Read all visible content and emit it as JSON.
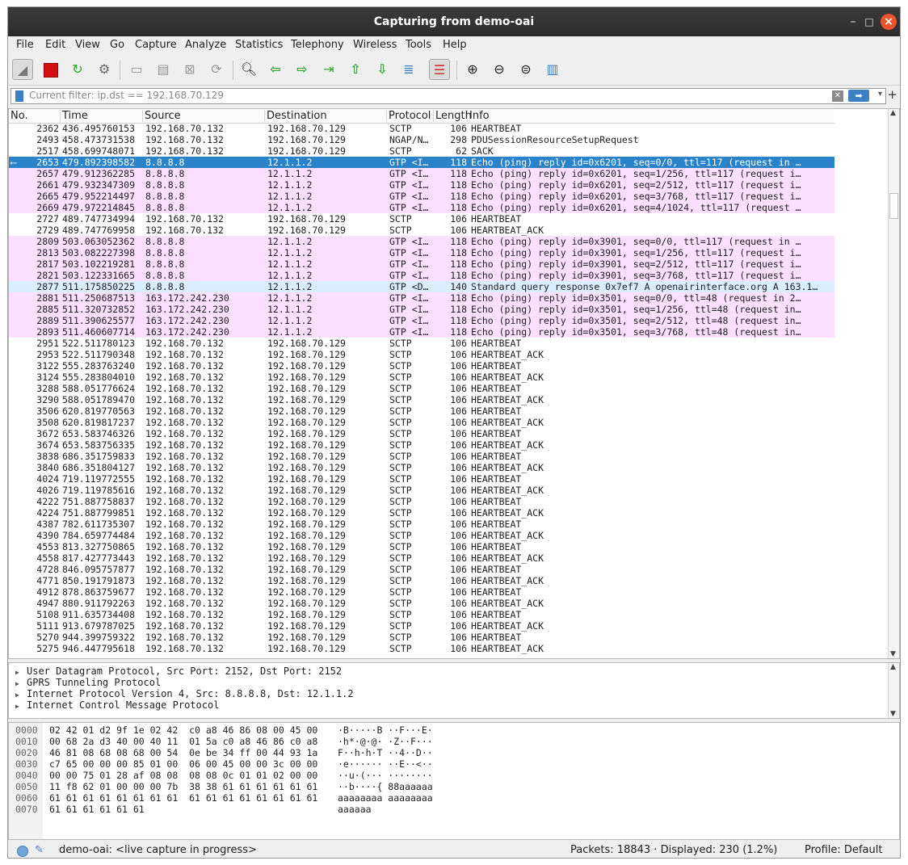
{
  "window": {
    "title": "Capturing from demo-oai"
  },
  "menu": [
    "File",
    "Edit",
    "View",
    "Go",
    "Capture",
    "Analyze",
    "Statistics",
    "Telephony",
    "Wireless",
    "Tools",
    "Help"
  ],
  "filter": {
    "placeholder": "Current filter: ip.dst == 192.168.70.129",
    "value": ""
  },
  "columns": [
    "No.",
    "Time",
    "Source",
    "Destination",
    "Protocol",
    "Length",
    "Info"
  ],
  "packets": [
    {
      "no": "2362",
      "time": "436.495760153",
      "src": "192.168.70.132",
      "dst": "192.168.70.129",
      "proto": "SCTP",
      "len": "106",
      "info": "HEARTBEAT",
      "style": "normal"
    },
    {
      "no": "2493",
      "time": "458.473731538",
      "src": "192.168.70.132",
      "dst": "192.168.70.129",
      "proto": "NGAP/N…",
      "len": "298",
      "info": "PDUSessionResourceSetupRequest",
      "style": "normal"
    },
    {
      "no": "2517",
      "time": "458.699748071",
      "src": "192.168.70.132",
      "dst": "192.168.70.129",
      "proto": "SCTP",
      "len": "62",
      "info": "SACK",
      "style": "normal"
    },
    {
      "no": "2653",
      "time": "479.892398582",
      "src": "8.8.8.8",
      "dst": "12.1.1.2",
      "proto": "GTP <I…",
      "len": "118",
      "info": "Echo (ping) reply    id=0x6201, seq=0/0, ttl=117 (request in …",
      "style": "sel"
    },
    {
      "no": "2657",
      "time": "479.912362285",
      "src": "8.8.8.8",
      "dst": "12.1.1.2",
      "proto": "GTP <I…",
      "len": "118",
      "info": "Echo (ping) reply    id=0x6201, seq=1/256, ttl=117 (request i…",
      "style": "icmp"
    },
    {
      "no": "2661",
      "time": "479.932347309",
      "src": "8.8.8.8",
      "dst": "12.1.1.2",
      "proto": "GTP <I…",
      "len": "118",
      "info": "Echo (ping) reply    id=0x6201, seq=2/512, ttl=117 (request i…",
      "style": "icmp"
    },
    {
      "no": "2665",
      "time": "479.952214497",
      "src": "8.8.8.8",
      "dst": "12.1.1.2",
      "proto": "GTP <I…",
      "len": "118",
      "info": "Echo (ping) reply    id=0x6201, seq=3/768, ttl=117 (request i…",
      "style": "icmp"
    },
    {
      "no": "2669",
      "time": "479.972214845",
      "src": "8.8.8.8",
      "dst": "12.1.1.2",
      "proto": "GTP <I…",
      "len": "118",
      "info": "Echo (ping) reply    id=0x6201, seq=4/1024, ttl=117 (request …",
      "style": "icmp"
    },
    {
      "no": "2727",
      "time": "489.747734994",
      "src": "192.168.70.132",
      "dst": "192.168.70.129",
      "proto": "SCTP",
      "len": "106",
      "info": "HEARTBEAT",
      "style": "normal"
    },
    {
      "no": "2729",
      "time": "489.747769958",
      "src": "192.168.70.132",
      "dst": "192.168.70.129",
      "proto": "SCTP",
      "len": "106",
      "info": "HEARTBEAT_ACK",
      "style": "normal"
    },
    {
      "no": "2809",
      "time": "503.063052362",
      "src": "8.8.8.8",
      "dst": "12.1.1.2",
      "proto": "GTP <I…",
      "len": "118",
      "info": "Echo (ping) reply    id=0x3901, seq=0/0, ttl=117 (request in …",
      "style": "icmp"
    },
    {
      "no": "2813",
      "time": "503.082227398",
      "src": "8.8.8.8",
      "dst": "12.1.1.2",
      "proto": "GTP <I…",
      "len": "118",
      "info": "Echo (ping) reply    id=0x3901, seq=1/256, ttl=117 (request i…",
      "style": "icmp"
    },
    {
      "no": "2817",
      "time": "503.102219281",
      "src": "8.8.8.8",
      "dst": "12.1.1.2",
      "proto": "GTP <I…",
      "len": "118",
      "info": "Echo (ping) reply    id=0x3901, seq=2/512, ttl=117 (request i…",
      "style": "icmp"
    },
    {
      "no": "2821",
      "time": "503.122331665",
      "src": "8.8.8.8",
      "dst": "12.1.1.2",
      "proto": "GTP <I…",
      "len": "118",
      "info": "Echo (ping) reply    id=0x3901, seq=3/768, ttl=117 (request i…",
      "style": "icmp"
    },
    {
      "no": "2877",
      "time": "511.175850225",
      "src": "8.8.8.8",
      "dst": "12.1.1.2",
      "proto": "GTP <D…",
      "len": "140",
      "info": "Standard query response 0x7ef7 A openairinterface.org A 163.1…",
      "style": "dns"
    },
    {
      "no": "2881",
      "time": "511.250687513",
      "src": "163.172.242.230",
      "dst": "12.1.1.2",
      "proto": "GTP <I…",
      "len": "118",
      "info": "Echo (ping) reply    id=0x3501, seq=0/0, ttl=48 (request in 2…",
      "style": "icmp"
    },
    {
      "no": "2885",
      "time": "511.320732852",
      "src": "163.172.242.230",
      "dst": "12.1.1.2",
      "proto": "GTP <I…",
      "len": "118",
      "info": "Echo (ping) reply    id=0x3501, seq=1/256, ttl=48 (request in…",
      "style": "icmp"
    },
    {
      "no": "2889",
      "time": "511.390625577",
      "src": "163.172.242.230",
      "dst": "12.1.1.2",
      "proto": "GTP <I…",
      "len": "118",
      "info": "Echo (ping) reply    id=0x3501, seq=2/512, ttl=48 (request in…",
      "style": "icmp"
    },
    {
      "no": "2893",
      "time": "511.460607714",
      "src": "163.172.242.230",
      "dst": "12.1.1.2",
      "proto": "GTP <I…",
      "len": "118",
      "info": "Echo (ping) reply    id=0x3501, seq=3/768, ttl=48 (request in…",
      "style": "icmp"
    },
    {
      "no": "2951",
      "time": "522.511780123",
      "src": "192.168.70.132",
      "dst": "192.168.70.129",
      "proto": "SCTP",
      "len": "106",
      "info": "HEARTBEAT",
      "style": "normal"
    },
    {
      "no": "2953",
      "time": "522.511790348",
      "src": "192.168.70.132",
      "dst": "192.168.70.129",
      "proto": "SCTP",
      "len": "106",
      "info": "HEARTBEAT_ACK",
      "style": "normal"
    },
    {
      "no": "3122",
      "time": "555.283763240",
      "src": "192.168.70.132",
      "dst": "192.168.70.129",
      "proto": "SCTP",
      "len": "106",
      "info": "HEARTBEAT",
      "style": "normal"
    },
    {
      "no": "3124",
      "time": "555.283804010",
      "src": "192.168.70.132",
      "dst": "192.168.70.129",
      "proto": "SCTP",
      "len": "106",
      "info": "HEARTBEAT_ACK",
      "style": "normal"
    },
    {
      "no": "3288",
      "time": "588.051776624",
      "src": "192.168.70.132",
      "dst": "192.168.70.129",
      "proto": "SCTP",
      "len": "106",
      "info": "HEARTBEAT",
      "style": "normal"
    },
    {
      "no": "3290",
      "time": "588.051789470",
      "src": "192.168.70.132",
      "dst": "192.168.70.129",
      "proto": "SCTP",
      "len": "106",
      "info": "HEARTBEAT_ACK",
      "style": "normal"
    },
    {
      "no": "3506",
      "time": "620.819770563",
      "src": "192.168.70.132",
      "dst": "192.168.70.129",
      "proto": "SCTP",
      "len": "106",
      "info": "HEARTBEAT",
      "style": "normal"
    },
    {
      "no": "3508",
      "time": "620.819817237",
      "src": "192.168.70.132",
      "dst": "192.168.70.129",
      "proto": "SCTP",
      "len": "106",
      "info": "HEARTBEAT_ACK",
      "style": "normal"
    },
    {
      "no": "3672",
      "time": "653.583746326",
      "src": "192.168.70.132",
      "dst": "192.168.70.129",
      "proto": "SCTP",
      "len": "106",
      "info": "HEARTBEAT",
      "style": "normal"
    },
    {
      "no": "3674",
      "time": "653.583756335",
      "src": "192.168.70.132",
      "dst": "192.168.70.129",
      "proto": "SCTP",
      "len": "106",
      "info": "HEARTBEAT_ACK",
      "style": "normal"
    },
    {
      "no": "3838",
      "time": "686.351759833",
      "src": "192.168.70.132",
      "dst": "192.168.70.129",
      "proto": "SCTP",
      "len": "106",
      "info": "HEARTBEAT",
      "style": "normal"
    },
    {
      "no": "3840",
      "time": "686.351804127",
      "src": "192.168.70.132",
      "dst": "192.168.70.129",
      "proto": "SCTP",
      "len": "106",
      "info": "HEARTBEAT_ACK",
      "style": "normal"
    },
    {
      "no": "4024",
      "time": "719.119772555",
      "src": "192.168.70.132",
      "dst": "192.168.70.129",
      "proto": "SCTP",
      "len": "106",
      "info": "HEARTBEAT",
      "style": "normal"
    },
    {
      "no": "4026",
      "time": "719.119785616",
      "src": "192.168.70.132",
      "dst": "192.168.70.129",
      "proto": "SCTP",
      "len": "106",
      "info": "HEARTBEAT_ACK",
      "style": "normal"
    },
    {
      "no": "4222",
      "time": "751.887758837",
      "src": "192.168.70.132",
      "dst": "192.168.70.129",
      "proto": "SCTP",
      "len": "106",
      "info": "HEARTBEAT",
      "style": "normal"
    },
    {
      "no": "4224",
      "time": "751.887799851",
      "src": "192.168.70.132",
      "dst": "192.168.70.129",
      "proto": "SCTP",
      "len": "106",
      "info": "HEARTBEAT_ACK",
      "style": "normal"
    },
    {
      "no": "4387",
      "time": "782.611735307",
      "src": "192.168.70.132",
      "dst": "192.168.70.129",
      "proto": "SCTP",
      "len": "106",
      "info": "HEARTBEAT",
      "style": "normal"
    },
    {
      "no": "4390",
      "time": "784.659774484",
      "src": "192.168.70.132",
      "dst": "192.168.70.129",
      "proto": "SCTP",
      "len": "106",
      "info": "HEARTBEAT_ACK",
      "style": "normal"
    },
    {
      "no": "4553",
      "time": "813.327750865",
      "src": "192.168.70.132",
      "dst": "192.168.70.129",
      "proto": "SCTP",
      "len": "106",
      "info": "HEARTBEAT",
      "style": "normal"
    },
    {
      "no": "4558",
      "time": "817.427773443",
      "src": "192.168.70.132",
      "dst": "192.168.70.129",
      "proto": "SCTP",
      "len": "106",
      "info": "HEARTBEAT_ACK",
      "style": "normal"
    },
    {
      "no": "4728",
      "time": "846.095757877",
      "src": "192.168.70.132",
      "dst": "192.168.70.129",
      "proto": "SCTP",
      "len": "106",
      "info": "HEARTBEAT",
      "style": "normal"
    },
    {
      "no": "4771",
      "time": "850.191791873",
      "src": "192.168.70.132",
      "dst": "192.168.70.129",
      "proto": "SCTP",
      "len": "106",
      "info": "HEARTBEAT_ACK",
      "style": "normal"
    },
    {
      "no": "4912",
      "time": "878.863759677",
      "src": "192.168.70.132",
      "dst": "192.168.70.129",
      "proto": "SCTP",
      "len": "106",
      "info": "HEARTBEAT",
      "style": "normal"
    },
    {
      "no": "4947",
      "time": "880.911792263",
      "src": "192.168.70.132",
      "dst": "192.168.70.129",
      "proto": "SCTP",
      "len": "106",
      "info": "HEARTBEAT_ACK",
      "style": "normal"
    },
    {
      "no": "5108",
      "time": "911.635734408",
      "src": "192.168.70.132",
      "dst": "192.168.70.129",
      "proto": "SCTP",
      "len": "106",
      "info": "HEARTBEAT",
      "style": "normal"
    },
    {
      "no": "5111",
      "time": "913.679787025",
      "src": "192.168.70.132",
      "dst": "192.168.70.129",
      "proto": "SCTP",
      "len": "106",
      "info": "HEARTBEAT_ACK",
      "style": "normal"
    },
    {
      "no": "5270",
      "time": "944.399759322",
      "src": "192.168.70.132",
      "dst": "192.168.70.129",
      "proto": "SCTP",
      "len": "106",
      "info": "HEARTBEAT",
      "style": "normal"
    },
    {
      "no": "5275",
      "time": "946.447795618",
      "src": "192.168.70.132",
      "dst": "192.168.70.129",
      "proto": "SCTP",
      "len": "106",
      "info": "HEARTBEAT_ACK",
      "style": "normal"
    }
  ],
  "details": [
    "User Datagram Protocol, Src Port: 2152, Dst Port: 2152",
    "GPRS Tunneling Protocol",
    "Internet Protocol Version 4, Src: 8.8.8.8, Dst: 12.1.1.2",
    "Internet Control Message Protocol"
  ],
  "hexdump": [
    {
      "off": "0000",
      "bytes": "02 42 01 d2 9f 1e 02 42  c0 a8 46 86 08 00 45 00",
      "ascii": "·B·····B ··F···E·"
    },
    {
      "off": "0010",
      "bytes": "00 68 2a d3 40 00 40 11  01 5a c0 a8 46 86 c0 a8",
      "ascii": "·h*·@·@· ·Z··F···"
    },
    {
      "off": "0020",
      "bytes": "46 81 08 68 08 68 00 54  0e be 34 ff 00 44 93 1a",
      "ascii": "F··h·h·T ··4··D··"
    },
    {
      "off": "0030",
      "bytes": "c7 65 00 00 00 85 01 00  06 00 45 00 00 3c 00 00",
      "ascii": "·e······ ··E··<··"
    },
    {
      "off": "0040",
      "bytes": "00 00 75 01 28 af 08 08  08 08 0c 01 01 02 00 00",
      "ascii": "··u·(··· ········"
    },
    {
      "off": "0050",
      "bytes": "11 f8 62 01 00 00 00 7b  38 38 61 61 61 61 61 61",
      "ascii": "··b····{ 88aaaaaa"
    },
    {
      "off": "0060",
      "bytes": "61 61 61 61 61 61 61 61  61 61 61 61 61 61 61 61",
      "ascii": "aaaaaaaa aaaaaaaa"
    },
    {
      "off": "0070",
      "bytes": "61 61 61 61 61 61",
      "ascii": "aaaaaa"
    }
  ],
  "status": {
    "capture": "demo-oai: <live capture in progress>",
    "packets": "Packets: 18843 · Displayed: 230 (1.2%)",
    "profile": "Profile: Default"
  },
  "colors": {
    "selected": "#2a83c8",
    "icmp": "#fce0ff",
    "dns": "#daeeff"
  }
}
